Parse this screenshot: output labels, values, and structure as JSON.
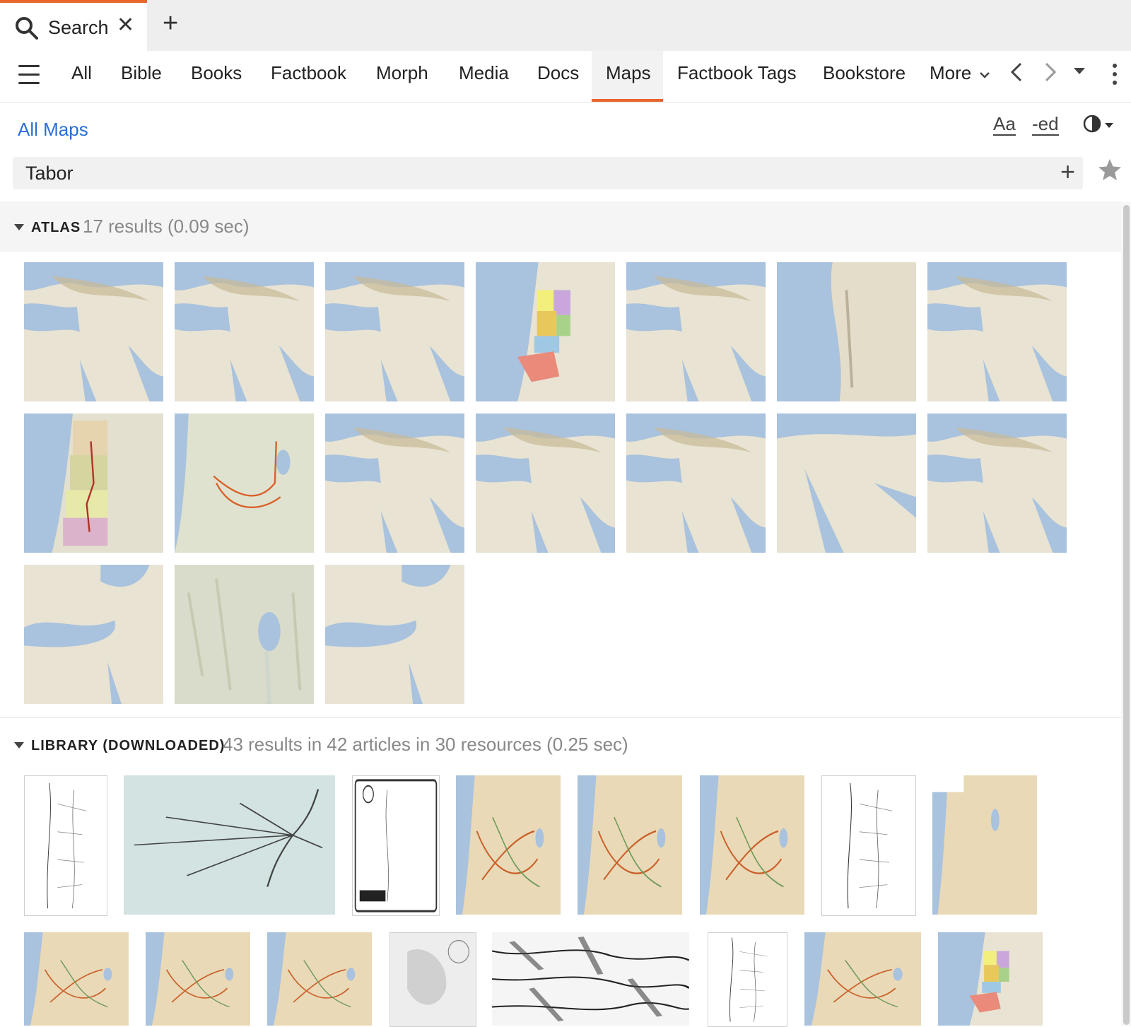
{
  "tab": {
    "title": "Search"
  },
  "nav": {
    "items": [
      "All",
      "Bible",
      "Books",
      "Factbook",
      "Morph",
      "Media",
      "Docs",
      "Maps",
      "Factbook Tags",
      "Bookstore"
    ],
    "more_label": "More",
    "active": "Maps"
  },
  "toolbar": {
    "breadcrumb": "All Maps",
    "font_button": "Aa",
    "ed_button": "-ed"
  },
  "search": {
    "value": "Tabor"
  },
  "atlas": {
    "name": "ATLAS",
    "stats": "17 results (0.09 sec)",
    "thumbnails": [
      "near-east",
      "near-east",
      "near-east",
      "tribal-allotments",
      "near-east",
      "levant-coast",
      "near-east",
      "tribal-route",
      "galilee-route",
      "near-east",
      "near-east",
      "near-east",
      "arabia",
      "near-east",
      "mediterranean",
      "galilee-relief",
      "mediterranean"
    ]
  },
  "library": {
    "name": "LIBRARY (DOWNLOADED)",
    "stats": "43 results in 42 articles in 30 resources (0.25 sec)",
    "thumbnails": [
      "line-map",
      "route-diagram",
      "framed-map",
      "relief-route",
      "relief-route",
      "relief-route",
      "line-map",
      "relief",
      "relief-route",
      "relief-route",
      "relief-route",
      "gray-map",
      "engraving",
      "line-map",
      "relief-route",
      "tribal-allotments"
    ]
  },
  "colors": {
    "accent": "#e8652c",
    "link": "#2a6fd6",
    "sea": "#a9c2de",
    "land": "#e8e3d2"
  }
}
